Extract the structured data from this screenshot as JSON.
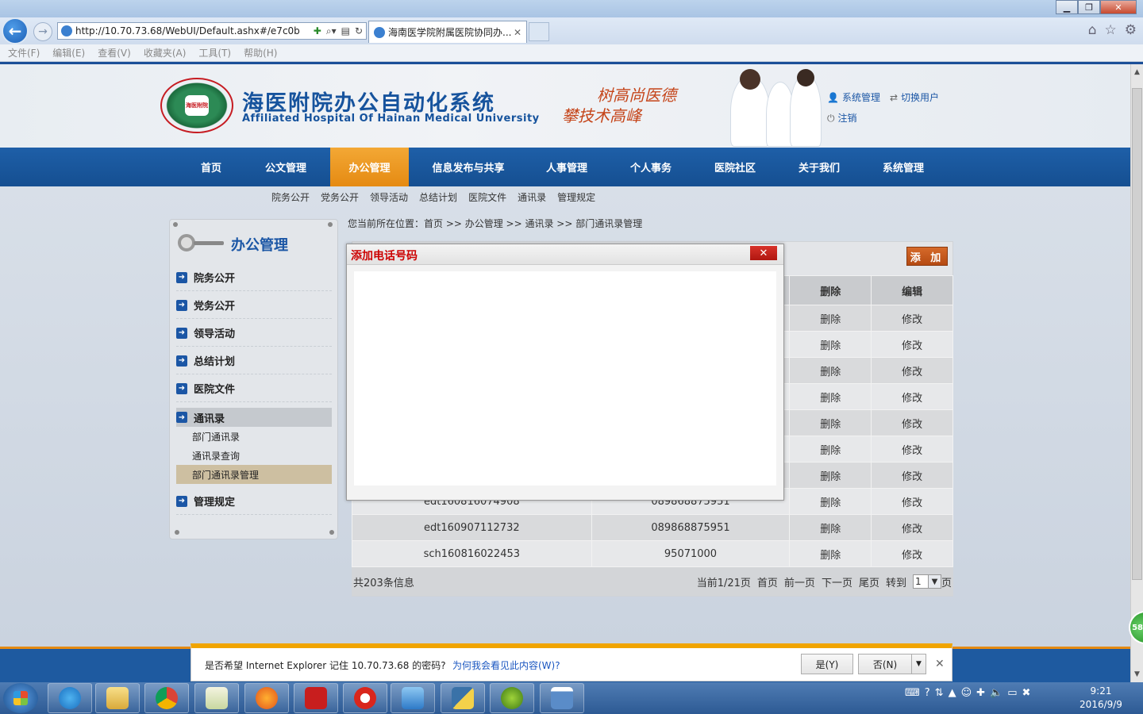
{
  "browser": {
    "url": "http://10.70.73.68/WebUI/Default.ashx#/e7c0b",
    "tab_title": "海南医学院附属医院协同办...",
    "menu": [
      "文件(F)",
      "编辑(E)",
      "查看(V)",
      "收藏夹(A)",
      "工具(T)",
      "帮助(H)"
    ]
  },
  "header": {
    "logo_text": "海医附院",
    "title": "海医附院办公自动化系统",
    "subtitle": "Affiliated Hospital Of Hainan Medical University",
    "slogan_line1": "树高尚医德",
    "slogan_line2": "攀技术高峰",
    "user_links": {
      "admin": "系统管理",
      "switch_user": "切换用户",
      "logout": "注销"
    }
  },
  "nav": {
    "items": [
      "首页",
      "公文管理",
      "办公管理",
      "信息发布与共享",
      "人事管理",
      "个人事务",
      "医院社区",
      "关于我们",
      "系统管理"
    ],
    "active": "办公管理"
  },
  "subnav": [
    "院务公开",
    "党务公开",
    "领导活动",
    "总结计划",
    "医院文件",
    "通讯录",
    "管理规定"
  ],
  "sidebar": {
    "title": "办公管理",
    "items": [
      "院务公开",
      "党务公开",
      "领导活动",
      "总结计划",
      "医院文件",
      "通讯录",
      "管理规定"
    ],
    "sub_items": [
      "部门通讯录",
      "通讯录查询",
      "部门通讯录管理"
    ]
  },
  "breadcrumb": "您当前所在位置：首页 >> 办公管理 >> 通讯录 >> 部门通讯录管理",
  "toolbar": {
    "add_label": "添 加"
  },
  "table": {
    "headers": [
      "删除",
      "编辑"
    ],
    "rows": [
      {
        "id": "",
        "phone": "",
        "del": "删除",
        "edit": "修改"
      },
      {
        "id": "",
        "phone": "",
        "del": "删除",
        "edit": "修改"
      },
      {
        "id": "",
        "phone": "",
        "del": "删除",
        "edit": "修改"
      },
      {
        "id": "",
        "phone": "",
        "del": "删除",
        "edit": "修改"
      },
      {
        "id": "",
        "phone": "",
        "del": "删除",
        "edit": "修改"
      },
      {
        "id": "",
        "phone": "",
        "del": "删除",
        "edit": "修改"
      },
      {
        "id": "",
        "phone": "",
        "del": "删除",
        "edit": "修改"
      },
      {
        "id": "edt160816074908",
        "phone": "089868875951",
        "del": "删除",
        "edit": "修改"
      },
      {
        "id": "edt160907112732",
        "phone": "089868875951",
        "del": "删除",
        "edit": "修改"
      },
      {
        "id": "sch160816022453",
        "phone": "95071000",
        "del": "删除",
        "edit": "修改"
      }
    ]
  },
  "pager": {
    "total": "共203条信息",
    "current": "当前1/21页",
    "first": "首页",
    "prev": "前一页",
    "next": "下一页",
    "last": "尾页",
    "goto": "转到",
    "page_value": "1",
    "page_suffix": "页"
  },
  "dialog": {
    "title": "添加电话号码",
    "close_label": "✕"
  },
  "notification": {
    "text": "是否希望 Internet Explorer 记住 10.70.73.68 的密码?",
    "link": "为何我会看见此内容(W)?",
    "yes": "是(Y)",
    "no": "否(N)"
  },
  "scroll_badge": "58",
  "taskbar": {
    "time": "9:21",
    "date": "2016/9/9"
  }
}
